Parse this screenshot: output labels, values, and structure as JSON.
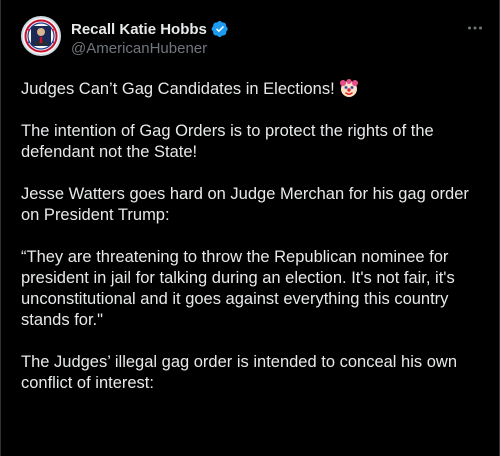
{
  "author": {
    "display_name": "Recall Katie Hobbs",
    "handle": "@AmericanHubener",
    "avatar_icon": "profile-avatar",
    "verified_icon": "verified-badge-icon",
    "verified_color": "#1d9bf0"
  },
  "menu": {
    "icon": "more-options-icon"
  },
  "tweet": {
    "paragraphs": [
      {
        "text": "Judges Can’t Gag Candidates in Elections!",
        "emoji": "clown-face-icon"
      },
      {
        "text": "The intention of Gag Orders is to protect the rights of the defendant not the State!"
      },
      {
        "text": "Jesse Watters goes hard on Judge Merchan for his gag order on President Trump:"
      },
      {
        "text": "“They are threatening to throw the Republican nominee for president in jail for talking during an election. It's not fair, it's unconstitutional and it goes against everything this country stands for.\""
      },
      {
        "text": "The Judges’ illegal gag order is intended to conceal his own conflict of interest:"
      }
    ]
  },
  "colors": {
    "background": "#000000",
    "text": "#e7e9ea",
    "secondary_text": "#71767b",
    "border": "#2f3336"
  }
}
